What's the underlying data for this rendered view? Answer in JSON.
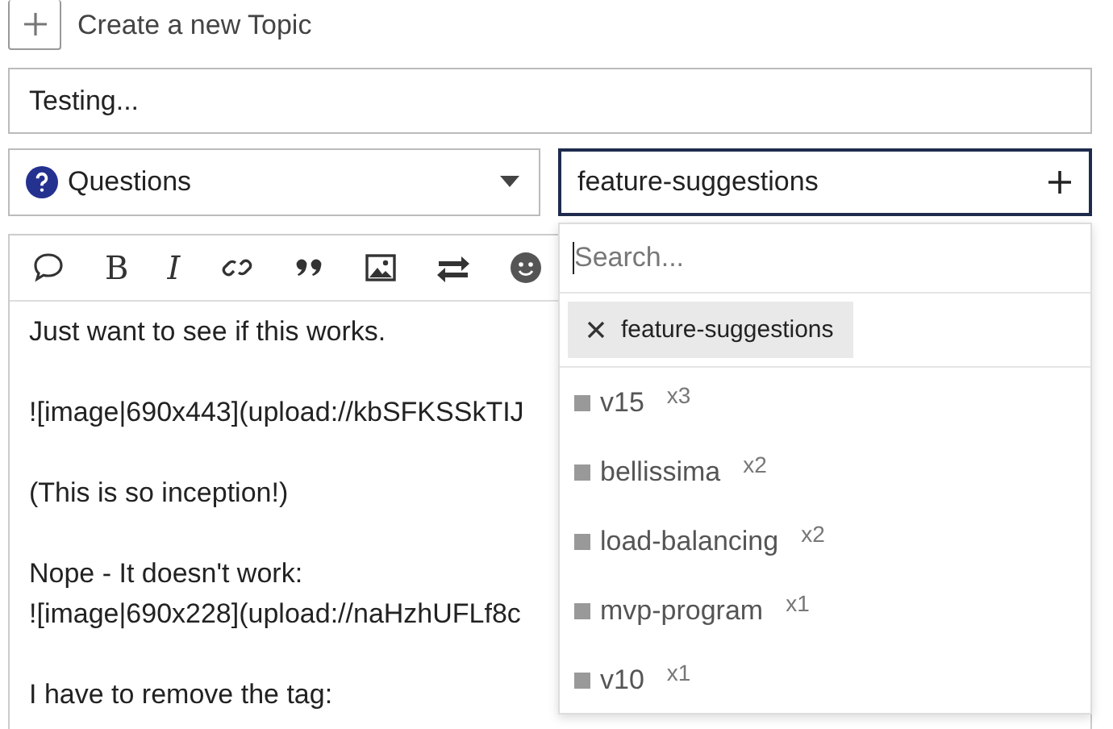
{
  "create_topic": {
    "label": "Create a new Topic"
  },
  "title_field": {
    "value": "Testing..."
  },
  "category": {
    "label": "Questions",
    "color": "#25318f"
  },
  "tag_field": {
    "value": "feature-suggestions"
  },
  "toolbar": [
    {
      "kind": "comment"
    },
    {
      "kind": "glyph",
      "text": "B"
    },
    {
      "kind": "glyph",
      "text": "I"
    },
    {
      "kind": "link"
    },
    {
      "kind": "quote"
    },
    {
      "kind": "image"
    },
    {
      "kind": "swap"
    },
    {
      "kind": "emoji"
    }
  ],
  "editor": {
    "paragraphs": [
      [
        "Just want to see if this works."
      ],
      [
        "![image|690x443](upload://kbSFKSSkTIJ"
      ],
      [
        "(This is so inception!)"
      ],
      [
        "Nope - It doesn't work:",
        "![image|690x228](upload://naHzhUFLf8c"
      ],
      [
        "I have to remove the tag:"
      ]
    ]
  },
  "tag_dropdown": {
    "search": {
      "placeholder": "Search..."
    },
    "selected_tags": [
      {
        "label": "feature-suggestions"
      }
    ],
    "options": [
      {
        "name": "v15",
        "count": "x3"
      },
      {
        "name": "bellissima",
        "count": "x2"
      },
      {
        "name": "load-balancing",
        "count": "x2"
      },
      {
        "name": "mvp-program",
        "count": "x1"
      },
      {
        "name": "v10",
        "count": "x1"
      }
    ]
  }
}
